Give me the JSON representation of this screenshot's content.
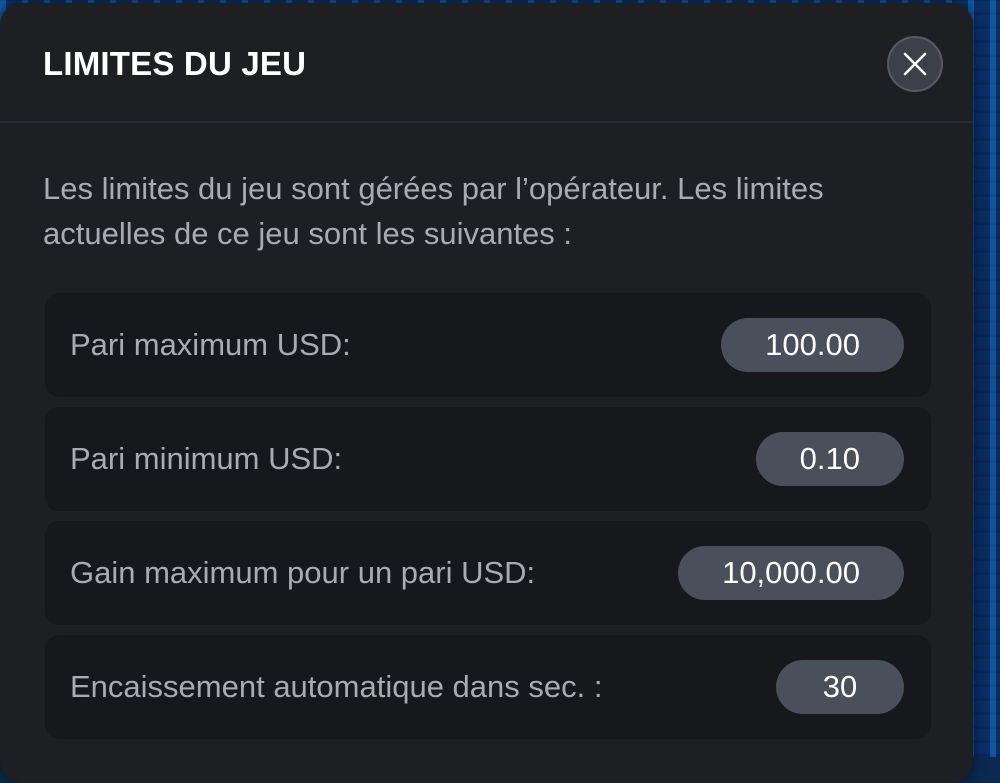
{
  "modal": {
    "title": "LIMITES DU JEU",
    "description": "Les limites du jeu sont gérées par l’opérateur. Les limites actuelles de ce jeu sont les suivantes :",
    "close_icon": "close-icon",
    "limits": [
      {
        "label": "Pari maximum USD:",
        "value": "100.00"
      },
      {
        "label": "Pari minimum USD:",
        "value": "0.10"
      },
      {
        "label": "Gain maximum pour un pari USD:",
        "value": "10,000.00"
      },
      {
        "label": "Encaissement automatique dans sec. :",
        "value": "30"
      }
    ]
  },
  "colors": {
    "modal_background": "#1e1f23",
    "row_background": "#17181c",
    "value_pill": "#4a4f5c",
    "title_text": "#ffffff",
    "body_text": "#a9abb3"
  }
}
